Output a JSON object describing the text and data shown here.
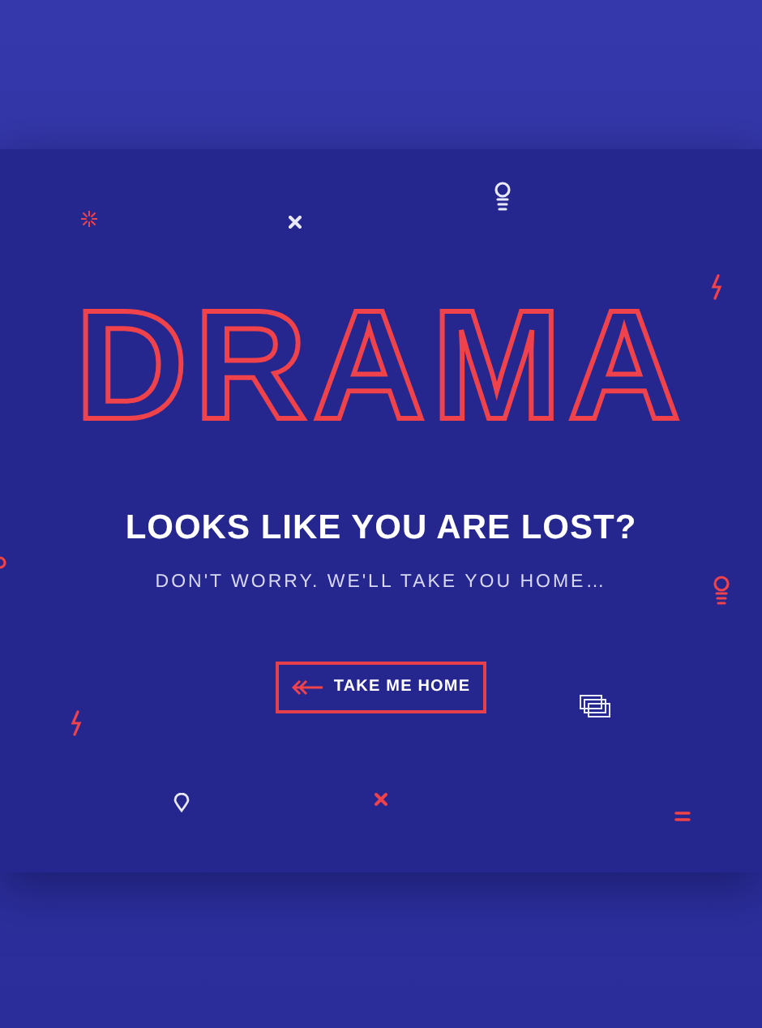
{
  "logo": "DRAMA",
  "heading": "LOOKS LIKE YOU ARE LOST?",
  "subheading": "DON'T WORRY. WE'LL TAKE YOU HOME…",
  "button": {
    "label": "TAKE ME HOME"
  }
}
